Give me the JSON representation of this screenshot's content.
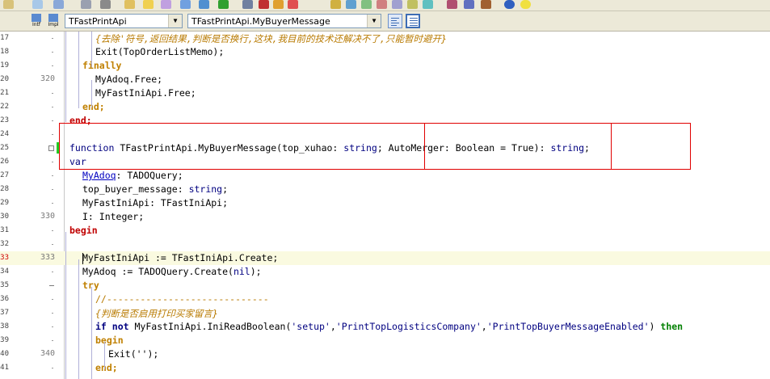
{
  "toolbar": {
    "combo_unit": "TFastPrintApi",
    "combo_method": "TFastPrintApi.MyBuyerMessage",
    "btn_intf": "Intf",
    "btn_impl": "Impl"
  },
  "editor": {
    "lines": [
      {
        "n": "17",
        "n10": ""
      },
      {
        "n": "18",
        "n10": ""
      },
      {
        "n": "19",
        "n10": ""
      },
      {
        "n": "20",
        "n10": "320"
      },
      {
        "n": "21",
        "n10": ""
      },
      {
        "n": "22",
        "n10": ""
      },
      {
        "n": "23",
        "n10": ""
      },
      {
        "n": "24",
        "n10": ""
      },
      {
        "n": "25",
        "n10": ""
      },
      {
        "n": "26",
        "n10": ""
      },
      {
        "n": "27",
        "n10": ""
      },
      {
        "n": "28",
        "n10": ""
      },
      {
        "n": "29",
        "n10": ""
      },
      {
        "n": "30",
        "n10": "330"
      },
      {
        "n": "31",
        "n10": ""
      },
      {
        "n": "32",
        "n10": ""
      },
      {
        "n": "33",
        "n10": "333"
      },
      {
        "n": "34",
        "n10": ""
      },
      {
        "n": "35",
        "n10": ""
      },
      {
        "n": "36",
        "n10": ""
      },
      {
        "n": "37",
        "n10": ""
      },
      {
        "n": "38",
        "n10": ""
      },
      {
        "n": "39",
        "n10": ""
      },
      {
        "n": "40",
        "n10": "340"
      },
      {
        "n": "41",
        "n10": ""
      }
    ],
    "code": {
      "l17": "{去除'符号,返回结果,判断是否换行,这块,我目前的技术还解决不了,只能暂时避开}",
      "l18": "Exit(TopOrderListMemo);",
      "l19": "finally",
      "l20": "MyAdoq.Free;",
      "l21": "MyFastIniApi.Free;",
      "l22": "end;",
      "l23": "end;",
      "l25_kw": "function",
      "l25_a": " TFastPrintApi.MyBuyerMessage(top_xuhao: ",
      "l25_b": "string",
      "l25_c": "; AutoMerger: Boolean = True): ",
      "l25_d": "string",
      "l25_e": ";",
      "l26": "var",
      "l27_a": "MyAdoq",
      "l27_b": ": TADOQuery;",
      "l28_a": "top_buyer_message: ",
      "l28_b": "string",
      "l28_c": ";",
      "l29": "MyFastIniApi: TFastIniApi;",
      "l30": "I: Integer;",
      "l31": "begin",
      "l33": "MyFastIniApi := TFastIniApi.Create;",
      "l34_a": "MyAdoq := TADOQuery.Create(",
      "l34_b": "nil",
      "l34_c": ");",
      "l35": "try",
      "l36": "//-----------------------------",
      "l37": "{判断是否启用打印买家留言}",
      "l38_a": "if",
      "l38_b": " ",
      "l38_c": "not",
      "l38_d": " MyFastIniApi.IniReadBoolean(",
      "l38_e": "'setup'",
      "l38_f": ",",
      "l38_g": "'PrintTopLogisticsCompany'",
      "l38_h": ",",
      "l38_i": "'PrintTopBuyerMessageEnabled'",
      "l38_j": ") ",
      "l38_k": "then",
      "l39": "begin",
      "l40": "Exit('');",
      "l41": "end;"
    }
  },
  "colors": {
    "highlight_box": "#e00000",
    "keyword": "#000080",
    "keyword_block": "#c08000",
    "keyword_red": "#c00000",
    "comment": "#b87a00",
    "then": "#008000"
  }
}
